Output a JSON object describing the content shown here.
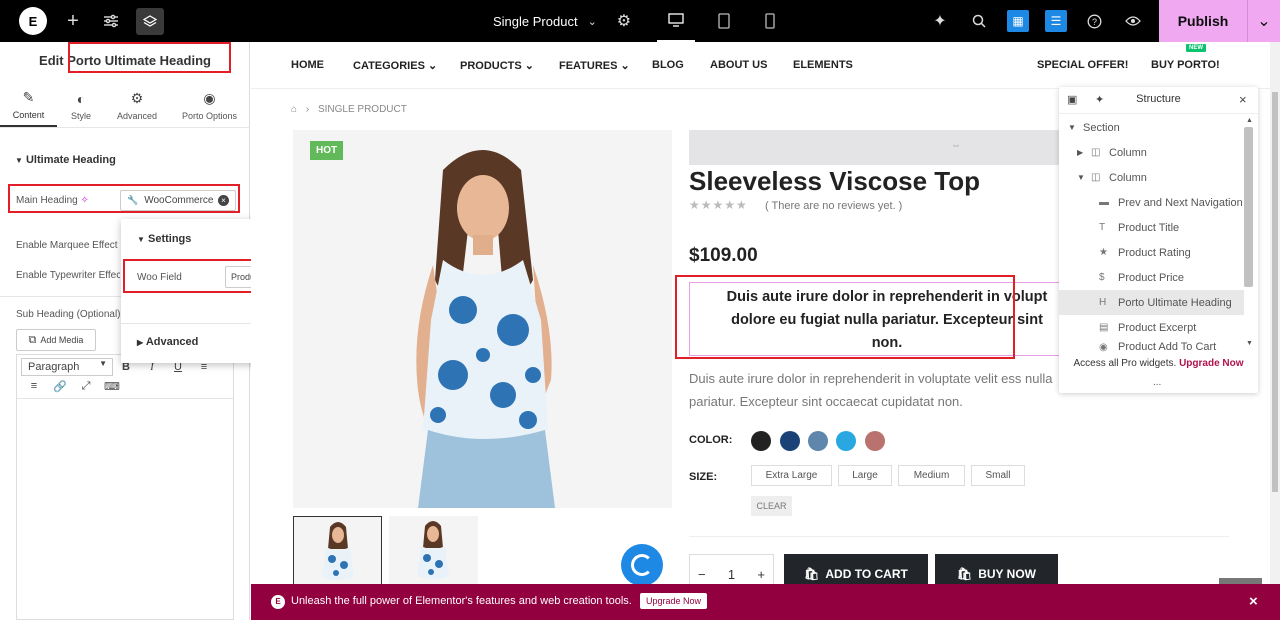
{
  "topbar": {
    "logo": "E",
    "add_icon": "plus-icon",
    "page_name": "Single Product",
    "publish_label": "Publish",
    "device_icons": [
      "desktop-icon",
      "tablet-icon",
      "mobile-icon"
    ]
  },
  "panel": {
    "title": "Edit Porto Ultimate Heading",
    "tabs": [
      {
        "label": "Content",
        "icon": "pencil-icon"
      },
      {
        "label": "Style",
        "icon": "half-circle-icon"
      },
      {
        "label": "Advanced",
        "icon": "gear-icon"
      },
      {
        "label": "Porto Options",
        "icon": "porto-icon"
      }
    ],
    "section_title": "Ultimate Heading",
    "main_heading_label": "Main Heading",
    "main_heading_value": "WooCommerce",
    "enable_marquee_label": "Enable Marquee Effect",
    "enable_typewriter_label": "Enable Typewriter Effec",
    "sub_heading_label": "Sub Heading (Optional)",
    "add_media_label": "Add Media",
    "paragraph_select": "Paragraph",
    "toolbar": [
      "B",
      "I",
      "U"
    ]
  },
  "popup": {
    "settings_label": "Settings",
    "woo_field_label": "Woo Field",
    "woo_field_value": "Product Short De",
    "advanced_label": "Advanced"
  },
  "site": {
    "nav": [
      "HOME",
      "CATEGORIES",
      "PRODUCTS",
      "FEATURES",
      "BLOG",
      "ABOUT US",
      "ELEMENTS"
    ],
    "special_offer": "SPECIAL OFFER!",
    "buy_porto": "BUY PORTO!",
    "new_badge": "NEW",
    "breadcrumb": "SINGLE PRODUCT",
    "hot_badge": "HOT",
    "product_title": "Sleeveless Viscose Top",
    "reviews": "( There are no reviews yet. )",
    "price": "$109.00",
    "heading_line1": "Duis aute irure dolor in reprehenderit in volupt",
    "heading_line2": "dolore eu fugiat nulla pariatur. Excepteur sint",
    "heading_line3": "non.",
    "excerpt": "Duis aute irure dolor in reprehenderit in voluptate velit ess nulla pariatur. Excepteur sint occaecat cupidatat non.",
    "color_label": "COLOR:",
    "colors": [
      "#222222",
      "#1b4277",
      "#5f86ad",
      "#29a7e1",
      "#b9726e"
    ],
    "size_label": "SIZE:",
    "sizes": [
      "Extra Large",
      "Large",
      "Medium",
      "Small"
    ],
    "clear_label": "CLEAR",
    "qty": "1",
    "add_to_cart": "ADD TO CART",
    "buy_now": "BUY NOW"
  },
  "structure": {
    "title": "Structure",
    "items": [
      {
        "label": "Section"
      },
      {
        "label": "Column"
      },
      {
        "label": "Column"
      },
      {
        "label": "Prev and Next Navigation"
      },
      {
        "label": "Product Title"
      },
      {
        "label": "Product Rating"
      },
      {
        "label": "Product Price"
      },
      {
        "label": "Porto Ultimate Heading"
      },
      {
        "label": "Product Excerpt"
      },
      {
        "label": "Product Add To Cart"
      }
    ],
    "footer_text": "Access all Pro widgets.",
    "footer_link": "Upgrade Now",
    "dots": "..."
  },
  "promo": {
    "text": "Unleash the full power of Elementor's features and web creation tools.",
    "button": "Upgrade Now"
  }
}
